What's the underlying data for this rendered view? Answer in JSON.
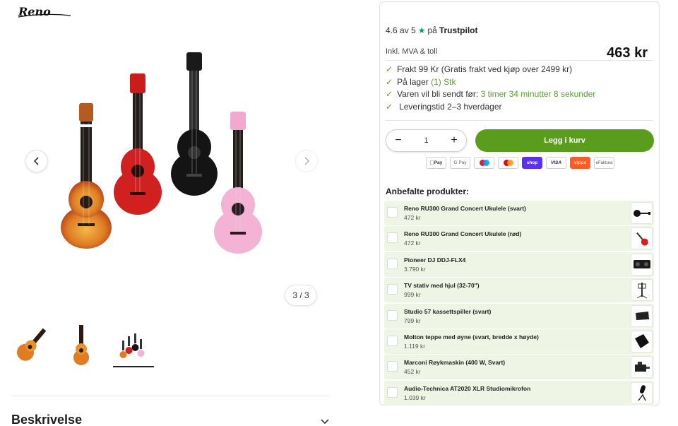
{
  "brand": {
    "logo_text": "Reno",
    "logo_sub": ""
  },
  "gallery": {
    "counter": "3 / 3",
    "thumbnails": [
      "Ukulele enkel",
      "Ukulele stående",
      "Fire ukuleler"
    ],
    "active_index": 3
  },
  "description": {
    "title": "Beskrivelse"
  },
  "rating": {
    "score": "4.6 av 5",
    "star": "★",
    "on": "på",
    "provider": "Trustpilot"
  },
  "vat_label": "Inkl. MVA & toll",
  "price": "463 kr",
  "info": {
    "check": "✓",
    "shipping": "Frakt 99 Kr (Gratis frakt ved kjøp over 2499 kr)",
    "stock_prefix": "På lager",
    "stock_value": "(1) Stk",
    "send_prefix": "Varen vil bli sendt før:",
    "send_time": "3 timer 34 minutter 8 sekunder",
    "delivery": "Leveringstid 2–3 hverdager"
  },
  "quantity": {
    "minus": "−",
    "value": "1",
    "plus": "+"
  },
  "cart_button": "Legg i kurv",
  "payments": [
    {
      "label": "Pay",
      "bg": "#ffffff",
      "fg": "#000000"
    },
    {
      "label": "G Pay",
      "bg": "#ffffff",
      "fg": "#5f6368"
    },
    {
      "label": "",
      "bg": "#ffffff",
      "fg": "#000000"
    },
    {
      "label": "",
      "bg": "#ffffff",
      "fg": "#000000"
    },
    {
      "label": "shop",
      "bg": "#5a31f4",
      "fg": "#ffffff"
    },
    {
      "label": "VISA",
      "bg": "#ffffff",
      "fg": "#1a1f71"
    },
    {
      "label": "vipps",
      "bg": "#ff5b24",
      "fg": "#ffffff"
    },
    {
      "label": "eFaktura",
      "bg": "#ffffff",
      "fg": "#555555"
    }
  ],
  "recommended": {
    "title": "Anbefalte produkter:",
    "items": [
      {
        "name": "Reno RU300 Grand Concert Ukulele (svart)",
        "price": "472 kr",
        "icon": "guitar-black-icon"
      },
      {
        "name": "Reno RU300 Grand Concert Ukulele (rød)",
        "price": "472 kr",
        "icon": "guitar-red-icon"
      },
      {
        "name": "Pioneer DJ DDJ-FLX4",
        "price": "3.790 kr",
        "icon": "dj-controller-icon"
      },
      {
        "name": "TV stativ med hjul (32-70\")",
        "price": "999 kr",
        "icon": "tv-stand-icon"
      },
      {
        "name": "Studio 57 kassettspiller (svart)",
        "price": "799 kr",
        "icon": "cassette-player-icon"
      },
      {
        "name": "Molton teppe med øyne (svart, bredde x høyde)",
        "price": "1.119 kr",
        "icon": "blanket-icon"
      },
      {
        "name": "Marconi Røykmaskin (400 W, Svart)",
        "price": "452 kr",
        "icon": "smoke-machine-icon"
      },
      {
        "name": "Audio-Technica AT2020 XLR Studiomikrofon",
        "price": "1.039 kr",
        "icon": "microphone-icon"
      }
    ]
  },
  "colors": {
    "accent_green": "#5a9d1c",
    "recommend_bg": "#eef5e4",
    "trust_star": "#00a46b"
  }
}
